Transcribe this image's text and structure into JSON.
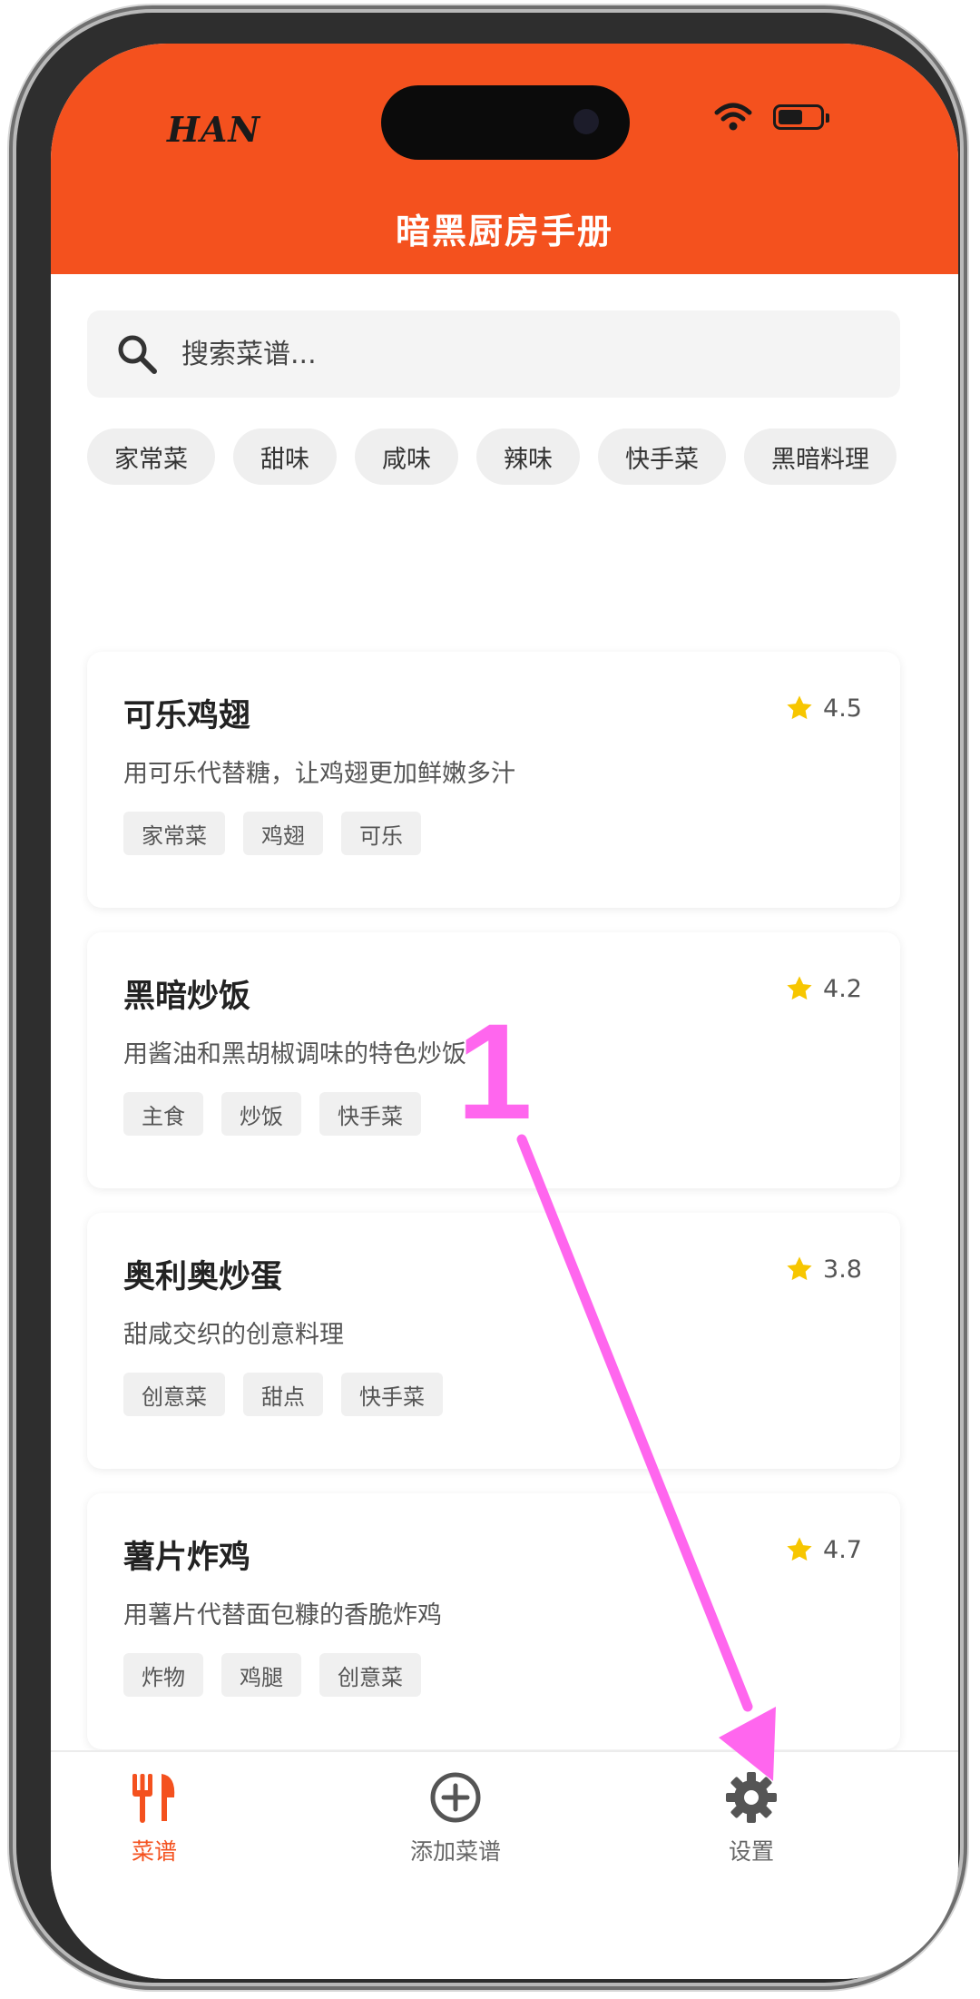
{
  "status_bar": {
    "carrier": "HAN"
  },
  "header": {
    "title": "暗黑厨房手册"
  },
  "search": {
    "placeholder": "搜索菜谱..."
  },
  "categories": [
    "家常菜",
    "甜味",
    "咸味",
    "辣味",
    "快手菜",
    "黑暗料理"
  ],
  "recipes": [
    {
      "title": "可乐鸡翅",
      "rating": "4.5",
      "desc": "用可乐代替糖，让鸡翅更加鲜嫩多汁",
      "tags": [
        "家常菜",
        "鸡翅",
        "可乐"
      ]
    },
    {
      "title": "黑暗炒饭",
      "rating": "4.2",
      "desc": "用酱油和黑胡椒调味的特色炒饭",
      "tags": [
        "主食",
        "炒饭",
        "快手菜"
      ]
    },
    {
      "title": "奥利奥炒蛋",
      "rating": "3.8",
      "desc": "甜咸交织的创意料理",
      "tags": [
        "创意菜",
        "甜点",
        "快手菜"
      ]
    },
    {
      "title": "薯片炸鸡",
      "rating": "4.7",
      "desc": "用薯片代替面包糠的香脆炸鸡",
      "tags": [
        "炸物",
        "鸡腿",
        "创意菜"
      ]
    }
  ],
  "tabs": [
    {
      "label": "菜谱",
      "icon": "utensils-icon",
      "active": true
    },
    {
      "label": "添加菜谱",
      "icon": "plus-circle-icon",
      "active": false
    },
    {
      "label": "设置",
      "icon": "gear-icon",
      "active": false
    }
  ],
  "annotation": {
    "label": "1",
    "color": "#ff66ee"
  },
  "colors": {
    "accent": "#f4511e",
    "star": "#f7c600"
  }
}
